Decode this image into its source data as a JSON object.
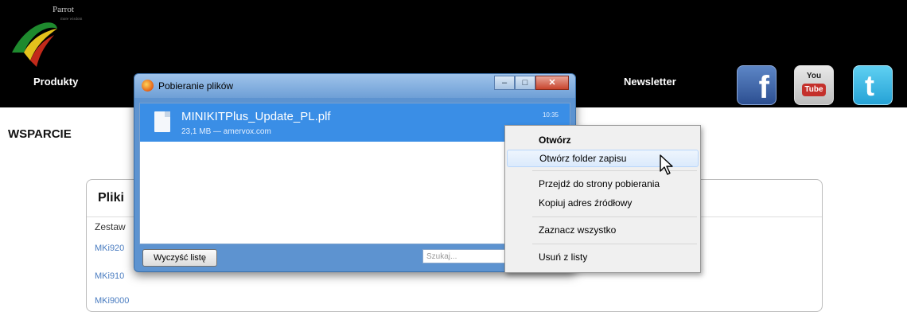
{
  "site": {
    "logo_text": "Parrot",
    "logo_tagline": "more wisdom",
    "nav": [
      "Produkty",
      "Newsletter"
    ],
    "social": {
      "facebook_letter": "f",
      "youtube_top": "You",
      "youtube_bottom": "Tube",
      "twitter_letter": "t"
    },
    "section_title": "WSPARCIE",
    "files_box": {
      "title": "Pliki",
      "subtitle": "Zestaw",
      "links": [
        "MKi920",
        "MKi910",
        "MKi9000"
      ]
    }
  },
  "downloads_window": {
    "title": "Pobieranie plików",
    "item": {
      "filename": "MINIKITPlus_Update_PL.plf",
      "info": "23,1 MB — amervox.com",
      "time": "10:35"
    },
    "clear_button": "Wyczyść listę",
    "search_placeholder": "Szukaj..."
  },
  "context_menu": {
    "items": [
      "Otwórz",
      "Otwórz folder zapisu",
      "Przejdź do strony pobierania",
      "Kopiuj adres źródłowy",
      "Zaznacz wszystko",
      "Usuń z listy"
    ]
  },
  "colors": {
    "header_bg": "#000000",
    "selection_blue": "#3a8ee6",
    "link_blue": "#4a7cc0"
  }
}
